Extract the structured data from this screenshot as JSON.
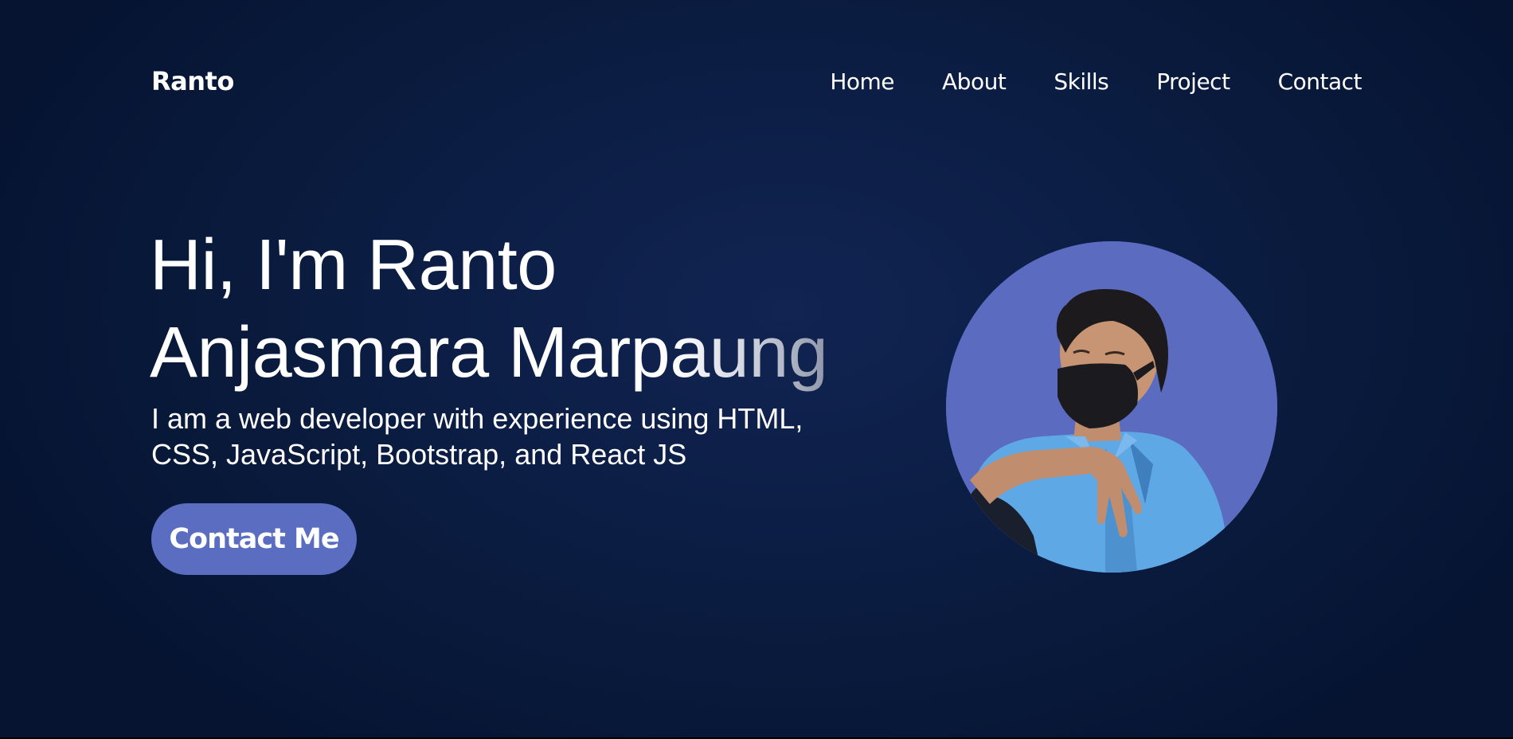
{
  "header": {
    "logo": "Ranto",
    "nav": [
      {
        "label": "Home"
      },
      {
        "label": "About"
      },
      {
        "label": "Skills"
      },
      {
        "label": "Project"
      },
      {
        "label": "Contact"
      }
    ]
  },
  "hero": {
    "title_line1": "Hi, I'm Ranto",
    "title_line2_solid": "Anjasmara Marp",
    "title_line2_fade": "aung",
    "subtitle": "I am a web developer with experience using HTML, CSS, JavaScript, Bootstrap, and React JS",
    "cta_label": "Contact Me"
  },
  "colors": {
    "background": "#0a1c40",
    "accent": "#5a6dc1",
    "text": "#ffffff"
  },
  "avatar": {
    "icon": "profile-photo"
  }
}
